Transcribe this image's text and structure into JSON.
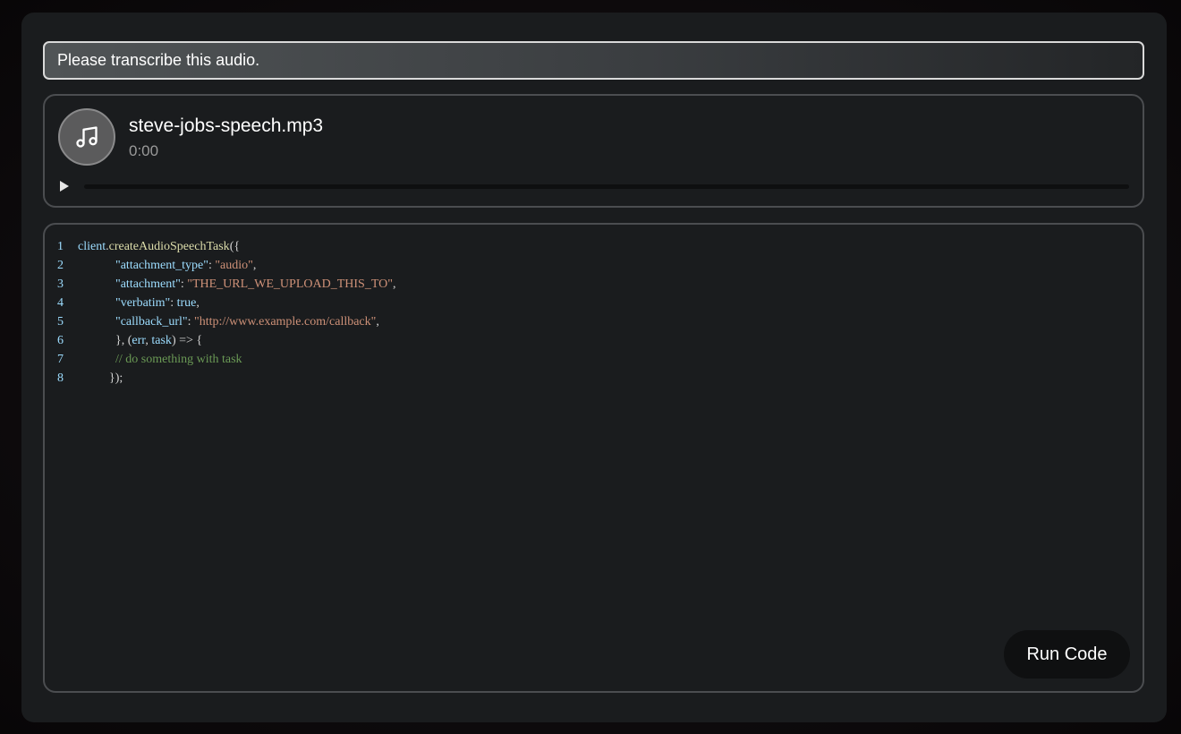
{
  "prompt": {
    "text": "Please transcribe this audio."
  },
  "audio": {
    "file_name": "steve-jobs-speech.mp3",
    "time": "0:00",
    "progress": 0,
    "icon": "music-note-icon"
  },
  "code": {
    "lines": [
      {
        "number": "1",
        "tokens": [
          {
            "t": "client",
            "c": "var"
          },
          {
            "t": ".",
            "c": "plain"
          },
          {
            "t": "createAudioSpeechTask",
            "c": "fn"
          },
          {
            "t": "({",
            "c": "plain"
          }
        ]
      },
      {
        "number": "2",
        "tokens": [
          {
            "t": "            ",
            "c": "plain"
          },
          {
            "t": "\"attachment_type\"",
            "c": "key"
          },
          {
            "t": ": ",
            "c": "plain"
          },
          {
            "t": "\"audio\"",
            "c": "str"
          },
          {
            "t": ",",
            "c": "plain"
          }
        ]
      },
      {
        "number": "3",
        "tokens": [
          {
            "t": "            ",
            "c": "plain"
          },
          {
            "t": "\"attachment\"",
            "c": "key"
          },
          {
            "t": ": ",
            "c": "plain"
          },
          {
            "t": "\"THE_URL_WE_UPLOAD_THIS_TO\"",
            "c": "str"
          },
          {
            "t": ",",
            "c": "plain"
          }
        ]
      },
      {
        "number": "4",
        "tokens": [
          {
            "t": "            ",
            "c": "plain"
          },
          {
            "t": "\"verbatim\"",
            "c": "key"
          },
          {
            "t": ": ",
            "c": "plain"
          },
          {
            "t": "true",
            "c": "var"
          },
          {
            "t": ",",
            "c": "plain"
          }
        ]
      },
      {
        "number": "5",
        "tokens": [
          {
            "t": "            ",
            "c": "plain"
          },
          {
            "t": "\"callback_url\"",
            "c": "key"
          },
          {
            "t": ": ",
            "c": "plain"
          },
          {
            "t": "\"http://www.example.com/callback\"",
            "c": "str"
          },
          {
            "t": ",",
            "c": "plain"
          }
        ]
      },
      {
        "number": "6",
        "tokens": [
          {
            "t": "            }, (",
            "c": "plain"
          },
          {
            "t": "err",
            "c": "var"
          },
          {
            "t": ", ",
            "c": "plain"
          },
          {
            "t": "task",
            "c": "var"
          },
          {
            "t": ") => {",
            "c": "plain"
          }
        ]
      },
      {
        "number": "7",
        "tokens": [
          {
            "t": "            ",
            "c": "plain"
          },
          {
            "t": "// do something with task",
            "c": "cmt"
          }
        ]
      },
      {
        "number": "8",
        "tokens": [
          {
            "t": "          });",
            "c": "plain"
          }
        ]
      }
    ]
  },
  "run_button": {
    "label": "Run Code"
  },
  "colors": {
    "variable": "#9cdcfe",
    "function": "#dcdcaa",
    "string": "#ce9178",
    "comment": "#6a9955",
    "plain": "#d4d4d4"
  }
}
